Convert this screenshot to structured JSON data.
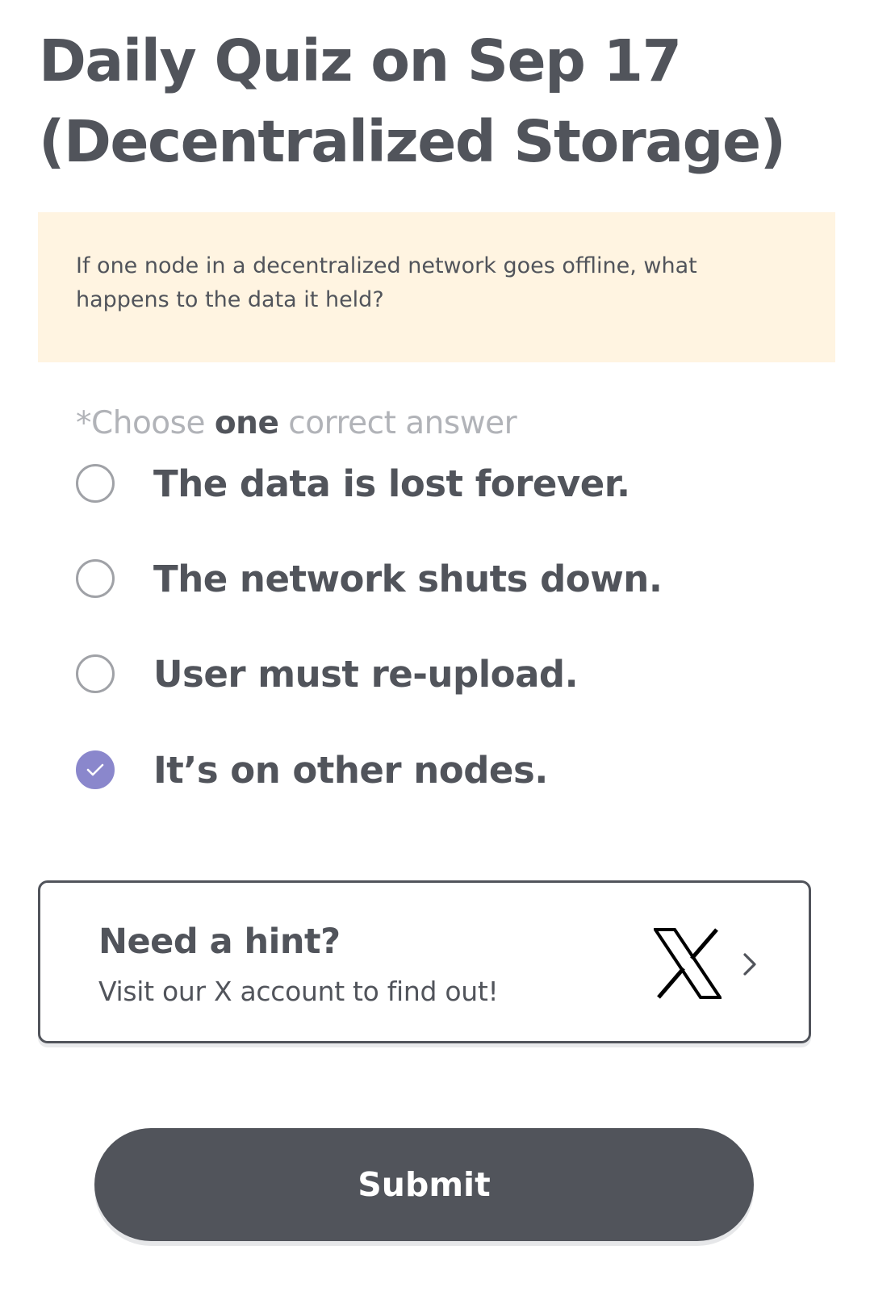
{
  "quiz": {
    "title_line1": "Daily Quiz on Sep 17",
    "title_line2": "(Decentralized Storage)",
    "question": "If one node in a decentralized network goes offline, what happens to the data it held?",
    "instruction": {
      "prefix": "*Choose ",
      "emphasis": "one",
      "suffix": " correct answer"
    },
    "options": [
      {
        "label": "The data is lost forever.",
        "selected": false
      },
      {
        "label": "The network shuts down.",
        "selected": false
      },
      {
        "label": "User must re-upload.",
        "selected": false
      },
      {
        "label": "It’s on other nodes.",
        "selected": true
      }
    ],
    "selected_index": 3
  },
  "hint": {
    "title": "Need a hint?",
    "subtitle": "Visit our X account to find out!",
    "icon": "x-logo-icon",
    "arrow_icon": "chevron-right-icon"
  },
  "submit": {
    "label": "Submit"
  },
  "colors": {
    "text": "#51545b",
    "muted": "#b1b3b8",
    "question_bg": "#fff4e1",
    "accent": "#8a87cc",
    "button_bg": "#51545b"
  }
}
